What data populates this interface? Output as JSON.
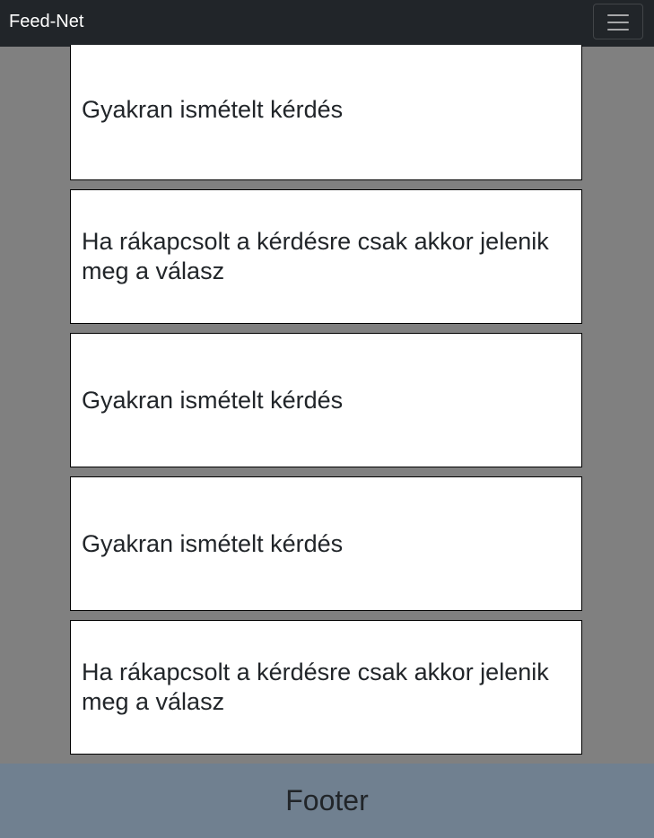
{
  "navbar": {
    "brand": "Feed-Net",
    "toggler_icon": "hamburger-menu-icon"
  },
  "faq": {
    "items": [
      {
        "question": "Gyakran ismételt kérdés"
      },
      {
        "question": "Ha rákapcsolt a kérdésre csak akkor jelenik meg a válasz"
      },
      {
        "question": "Gyakran ismételt kérdés"
      },
      {
        "question": "Gyakran ismételt kérdés"
      },
      {
        "question": "Ha rákapcsolt a kérdésre csak akkor jelenik meg a válasz"
      }
    ]
  },
  "footer": {
    "label": "Footer"
  },
  "colors": {
    "navbar_bg": "#212529",
    "page_bg": "#808080",
    "card_bg": "#ffffff",
    "footer_bg": "#708090"
  }
}
